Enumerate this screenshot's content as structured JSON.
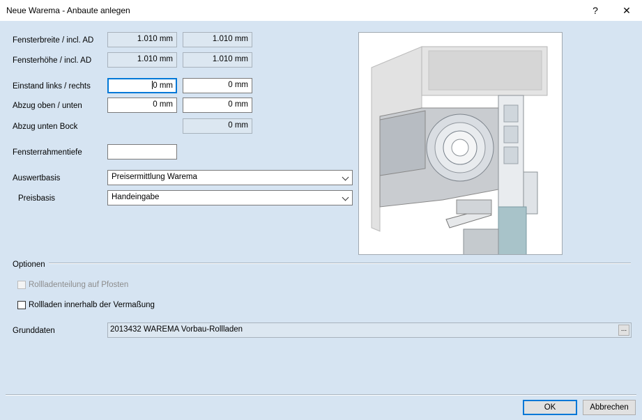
{
  "window": {
    "title": "Neue Warema - Anbaute anlegen",
    "help": "?",
    "close": "✕"
  },
  "fields": {
    "breite_label": "Fensterbreite / incl. AD",
    "breite_1": "1.010 mm",
    "breite_2": "1.010 mm",
    "hoehe_label": "Fensterhöhe / incl. AD",
    "hoehe_1": "1.010 mm",
    "hoehe_2": "1.010 mm",
    "einstand_label": "Einstand links / rechts",
    "einstand_links_rest": " mm",
    "einstand_rechts": "0 mm",
    "abzug_label": "Abzug oben / unten",
    "abzug_oben": "0 mm",
    "abzug_unten": "0 mm",
    "bock_label": "Abzug unten Bock",
    "bock_value": "0 mm",
    "rahmentiefe_label": "Fensterrahmentiefe",
    "rahmentiefe_value": ""
  },
  "combos": {
    "auswertbasis_label": "Auswertbasis",
    "auswertbasis_value": "Preisermittlung Warema",
    "preisbasis_label": "Preisbasis",
    "preisbasis_value": "Handeingabe"
  },
  "options": {
    "header": "Optionen",
    "pfosten_label": "Rollladenteilung auf Pfosten",
    "pfosten_checked": false,
    "pfosten_enabled": false,
    "vermassung_label": "Rollladen innerhalb der Vermaßung",
    "vermassung_checked": false
  },
  "grunddaten": {
    "label": "Grunddaten",
    "value": "2013432 WAREMA Vorbau-Rollladen",
    "browse": "..."
  },
  "buttons": {
    "ok": "OK",
    "cancel": "Abbrechen"
  }
}
